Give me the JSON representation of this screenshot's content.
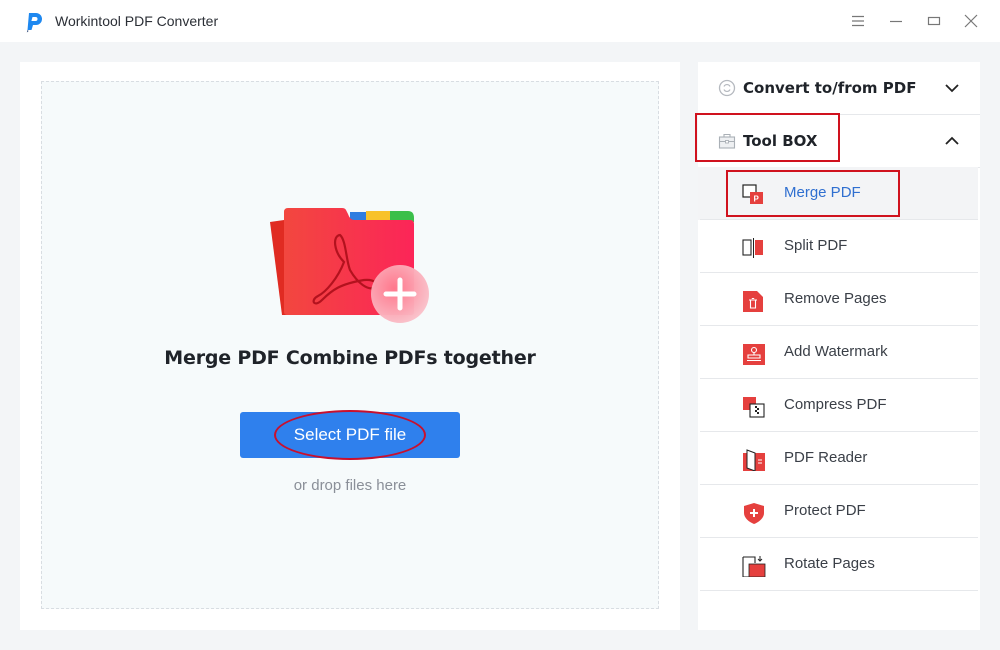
{
  "window": {
    "title": "Workintool PDF Converter",
    "controls": [
      "menu-icon",
      "minimize-icon",
      "maximize-icon",
      "close-icon"
    ]
  },
  "main": {
    "heading": "Merge PDF Combine PDFs together",
    "select_button": "Select PDF file",
    "drop_hint": "or drop files here"
  },
  "sidebar": {
    "sections": [
      {
        "label": "Convert to/from PDF",
        "icon": "convert-icon",
        "expanded": false
      },
      {
        "label": "Tool BOX",
        "icon": "toolbox-icon",
        "expanded": true
      }
    ],
    "tools": [
      {
        "label": "Merge PDF",
        "icon": "merge-pdf-icon",
        "active": true
      },
      {
        "label": "Split PDF",
        "icon": "split-pdf-icon",
        "active": false
      },
      {
        "label": "Remove Pages",
        "icon": "remove-pages-icon",
        "active": false
      },
      {
        "label": "Add Watermark",
        "icon": "watermark-icon",
        "active": false
      },
      {
        "label": "Compress PDF",
        "icon": "compress-pdf-icon",
        "active": false
      },
      {
        "label": "PDF Reader",
        "icon": "pdf-reader-icon",
        "active": false
      },
      {
        "label": "Protect PDF",
        "icon": "protect-pdf-icon",
        "active": false
      },
      {
        "label": "Rotate Pages",
        "icon": "rotate-pages-icon",
        "active": false
      }
    ]
  },
  "colors": {
    "accent_blue": "#2f80ed",
    "icon_red": "#e5403e",
    "annotation_red": "#d0121e"
  }
}
